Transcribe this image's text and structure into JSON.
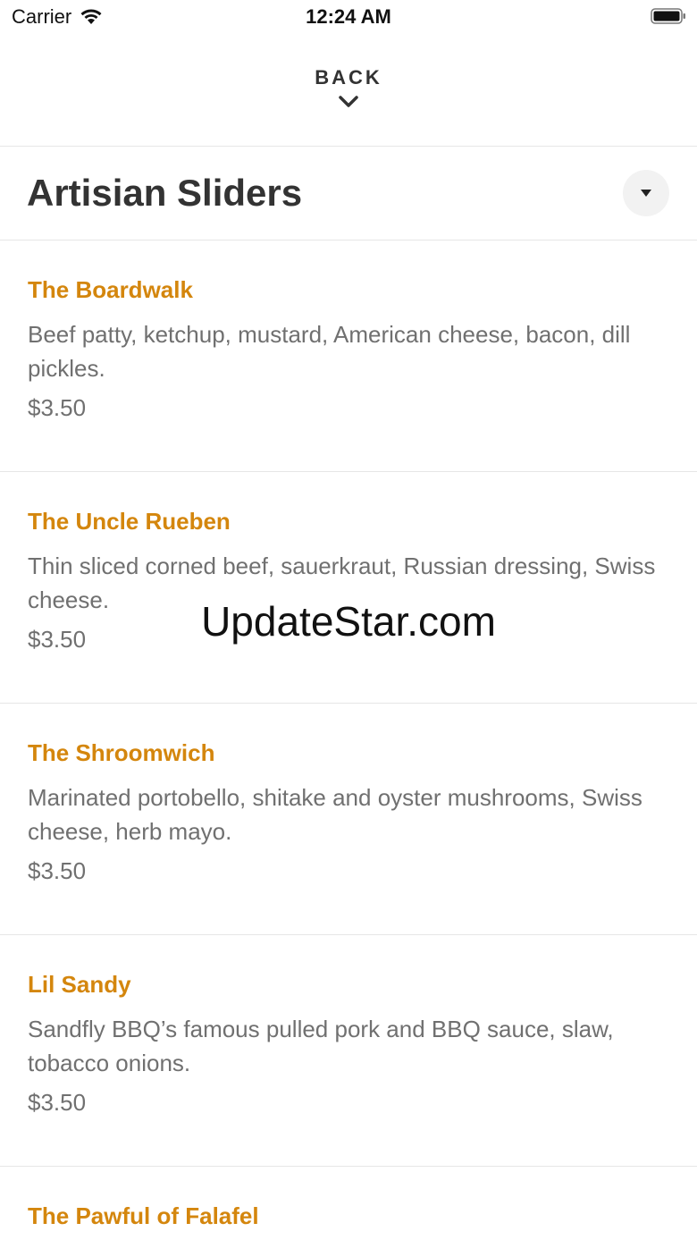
{
  "status_bar": {
    "carrier": "Carrier",
    "time": "12:24 AM",
    "wifi_icon": "wifi-icon",
    "battery_icon": "battery-icon"
  },
  "nav": {
    "back_label": "BACK",
    "chevron_icon": "chevron-down-icon"
  },
  "section": {
    "title": "Artisian Sliders",
    "dropdown_icon": "caret-down-icon"
  },
  "items": [
    {
      "name": "The Boardwalk",
      "description": "Beef patty, ketchup, mustard, American cheese, bacon, dill pickles.",
      "price": "$3.50"
    },
    {
      "name": "The Uncle Rueben",
      "description": "Thin sliced corned beef, sauerkraut, Russian dressing, Swiss cheese.",
      "price": "$3.50"
    },
    {
      "name": "The Shroomwich",
      "description": "Marinated portobello, shitake and oyster mushrooms, Swiss cheese, herb mayo.",
      "price": "$3.50"
    },
    {
      "name": "Lil Sandy",
      "description": "Sandfly BBQ’s famous pulled pork and BBQ sauce, slaw, tobacco onions.",
      "price": "$3.50"
    },
    {
      "name": "The Pawful of Falafel",
      "description": "",
      "price": ""
    }
  ],
  "watermark": "UpdateStar.com",
  "colors": {
    "accent": "#d4860d",
    "body_text": "#707070",
    "title_text": "#333333",
    "divider": "#e6e6e6"
  }
}
